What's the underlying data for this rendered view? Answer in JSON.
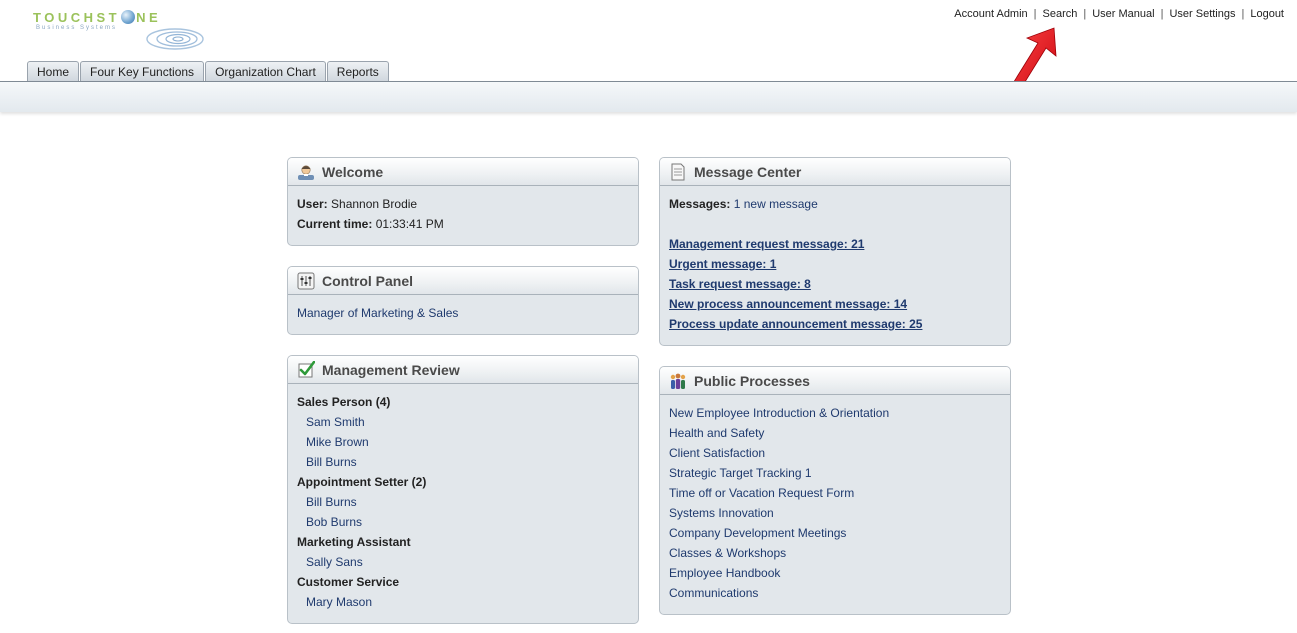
{
  "logo": {
    "brand_pre": "TOUCHST",
    "brand_post": "NE",
    "tagline": "Business Systems"
  },
  "top_links": [
    "Account Admin",
    "Search",
    "User Manual",
    "User Settings",
    "Logout"
  ],
  "tabs": [
    "Home",
    "Four Key Functions",
    "Organization Chart",
    "Reports"
  ],
  "welcome": {
    "title": "Welcome",
    "user_label": "User:",
    "user_value": "Shannon Brodie",
    "time_label": "Current time:",
    "time_value": "01:33:41 PM"
  },
  "control_panel": {
    "title": "Control Panel",
    "link": "Manager of Marketing & Sales"
  },
  "management_review": {
    "title": "Management Review",
    "groups": [
      {
        "label": "Sales Person (4)",
        "people": [
          "Sam Smith",
          "Mike Brown",
          "Bill Burns"
        ]
      },
      {
        "label": "Appointment Setter (2)",
        "people": [
          "Bill Burns",
          "Bob Burns"
        ]
      },
      {
        "label": "Marketing Assistant",
        "people": [
          "Sally Sans"
        ]
      },
      {
        "label": "Customer Service",
        "people": [
          "Mary Mason"
        ]
      }
    ]
  },
  "message_center": {
    "title": "Message Center",
    "messages_label": "Messages:",
    "messages_link": "1 new message",
    "counts": [
      "Management request message: 21",
      "Urgent message: 1",
      "Task request message: 8",
      "New process announcement message: 14",
      "Process update announcement message: 25"
    ]
  },
  "public_processes": {
    "title": "Public Processes",
    "items": [
      "New Employee Introduction & Orientation",
      "Health and Safety",
      "Client Satisfaction",
      "Strategic Target Tracking 1",
      "Time off or Vacation Request Form",
      "Systems Innovation",
      "Company Development Meetings",
      "Classes & Workshops",
      "Employee Handbook",
      "Communications"
    ]
  },
  "colors": {
    "link": "#1f3a6e",
    "panel_bg": "#e2e7eb",
    "arrow": "#e3101a",
    "brand_green": "#9bc25b"
  },
  "icons": {
    "welcome": "user-icon",
    "control_panel": "sliders-icon",
    "management_review": "checkmark-icon",
    "message_center": "document-icon",
    "public_processes": "people-icon"
  }
}
